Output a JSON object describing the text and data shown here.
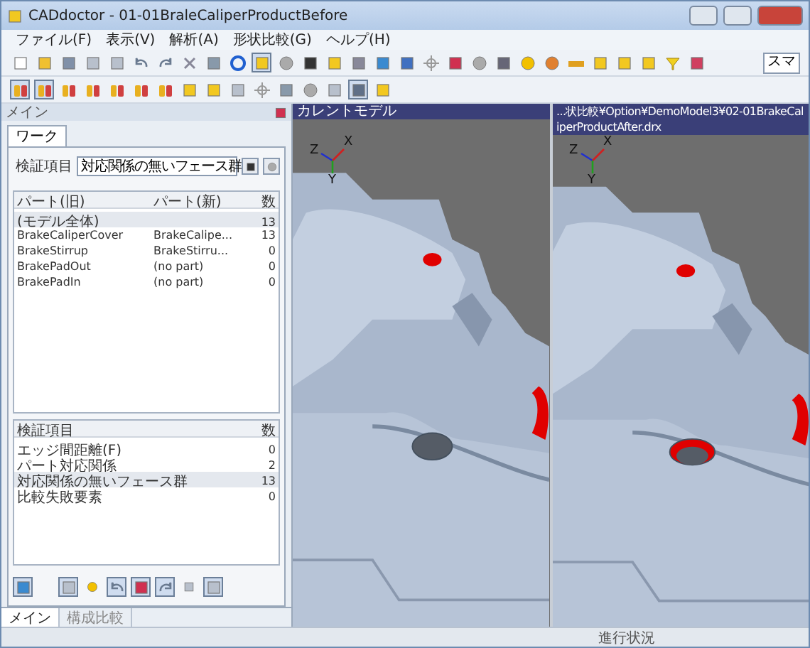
{
  "window": {
    "title": "CADdoctor - 01-01BraleCaliperProductBefore"
  },
  "menu": [
    "ファイル(F)",
    "表示(V)",
    "解析(A)",
    "形状比較(G)",
    "ヘルプ(H)"
  ],
  "toolbar": {
    "search_value": "スマ"
  },
  "panel": {
    "title": "メイン",
    "tab": "ワーク",
    "field_label": "検証項目",
    "select_value": "対応関係の無いフェース群",
    "parts_table": {
      "columns": [
        "パート(旧)",
        "パート(新)",
        "数"
      ],
      "rows": [
        {
          "cells": [
            "(モデル全体)",
            "",
            "13"
          ],
          "selected": true
        },
        {
          "cells": [
            "BrakeCaliperCover",
            "BrakeCalipe...",
            "13"
          ],
          "selected": false
        },
        {
          "cells": [
            "BrakeStirrup",
            "BrakeStirru...",
            "0"
          ],
          "selected": false
        },
        {
          "cells": [
            "BrakePadOut",
            "(no part)",
            "0"
          ],
          "selected": false
        },
        {
          "cells": [
            "BrakePadIn",
            "(no part)",
            "0"
          ],
          "selected": false
        }
      ]
    },
    "items_table": {
      "columns": [
        "検証項目",
        "数"
      ],
      "rows": [
        {
          "cells": [
            "エッジ間距離(F)",
            "0"
          ],
          "selected": false
        },
        {
          "cells": [
            "パート対応関係",
            "2"
          ],
          "selected": false
        },
        {
          "cells": [
            "対応関係の無いフェース群",
            "13"
          ],
          "selected": true
        },
        {
          "cells": [
            "比較失敗要素",
            "0"
          ],
          "selected": false
        }
      ]
    }
  },
  "bottom_tabs": [
    {
      "label": "メイン",
      "selected": true
    },
    {
      "label": "構成比較",
      "selected": false
    }
  ],
  "viewports": [
    {
      "title": "カレントモデル",
      "axes": [
        "Z",
        "X",
        "Y"
      ]
    },
    {
      "title": "...状比較¥Option¥DemoModel3¥02-01BrakeCaliperProductAfter.drx",
      "axes": [
        "Z",
        "X",
        "Y"
      ]
    }
  ],
  "status_bar": {
    "text": "進行状況"
  }
}
